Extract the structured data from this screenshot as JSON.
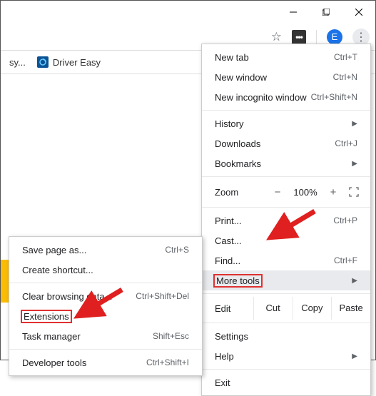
{
  "window": {
    "avatar_letter": "E"
  },
  "toolbar": {
    "ext_badge": "•••"
  },
  "bookmarks": {
    "item1_suffix": "sy...",
    "item2": "Driver Easy"
  },
  "menu": {
    "new_tab": "New tab",
    "new_tab_sc": "Ctrl+T",
    "new_window": "New window",
    "new_window_sc": "Ctrl+N",
    "new_incognito": "New incognito window",
    "new_incognito_sc": "Ctrl+Shift+N",
    "history": "History",
    "downloads": "Downloads",
    "downloads_sc": "Ctrl+J",
    "bookmarks": "Bookmarks",
    "zoom": "Zoom",
    "zoom_minus": "−",
    "zoom_val": "100%",
    "zoom_plus": "+",
    "print": "Print...",
    "print_sc": "Ctrl+P",
    "cast": "Cast...",
    "find": "Find...",
    "find_sc": "Ctrl+F",
    "more_tools": "More tools",
    "edit": "Edit",
    "cut": "Cut",
    "copy": "Copy",
    "paste": "Paste",
    "settings": "Settings",
    "help": "Help",
    "exit": "Exit"
  },
  "submenu": {
    "save_page": "Save page as...",
    "save_page_sc": "Ctrl+S",
    "create_shortcut": "Create shortcut...",
    "clear_data": "Clear browsing data...",
    "clear_data_sc": "Ctrl+Shift+Del",
    "extensions": "Extensions",
    "task_manager": "Task manager",
    "task_manager_sc": "Shift+Esc",
    "dev_tools": "Developer tools",
    "dev_tools_sc": "Ctrl+Shift+I"
  }
}
